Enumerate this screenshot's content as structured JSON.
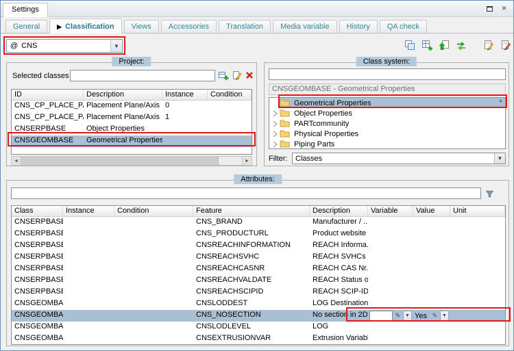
{
  "window": {
    "title": "Settings"
  },
  "tabs": {
    "items": [
      {
        "label": "General"
      },
      {
        "label": "Classification"
      },
      {
        "label": "Views"
      },
      {
        "label": "Accessories"
      },
      {
        "label": "Translation"
      },
      {
        "label": "Media variable"
      },
      {
        "label": "History"
      },
      {
        "label": "QA check"
      }
    ],
    "active": "Classification"
  },
  "class_combo": {
    "icon": "@",
    "value": "CNS"
  },
  "toolbar": {
    "icons": [
      "copy-table-icon",
      "add-table-icon",
      "import-icon",
      "transfer-icon",
      "edit-document-icon",
      "sign-document-icon"
    ]
  },
  "project": {
    "caption": "Project:",
    "selected_classes_label": "Selected classes",
    "search_value": "",
    "columns": [
      "ID",
      "Description",
      "Instance",
      "Condition"
    ],
    "rows": [
      {
        "id": "CNS_CP_PLACE_PA",
        "description": "Placement Plane/Axis",
        "instance": "0",
        "condition": ""
      },
      {
        "id": "CNS_CP_PLACE_PA",
        "description": "Placement Plane/Axis",
        "instance": "1",
        "condition": ""
      },
      {
        "id": "CNSERPBASE",
        "description": "Object Properties",
        "instance": "",
        "condition": ""
      },
      {
        "id": "CNSGEOMBASE",
        "description": "Geometrical Properties",
        "instance": "",
        "condition": ""
      }
    ],
    "selected_id": "CNSGEOMBASE"
  },
  "class_system": {
    "caption": "Class system:",
    "search_value": "",
    "selected_class_header": "CNSGEOMBASE - Geometrical Properties",
    "tree": [
      {
        "label": "Geometrical Properties"
      },
      {
        "label": "Object Properties"
      },
      {
        "label": "PARTcommunity"
      },
      {
        "label": "Physical Properties"
      },
      {
        "label": "Piping Parts"
      }
    ],
    "selected_item": "Geometrical Properties",
    "filter_label": "Filter:",
    "filter_value": "Classes"
  },
  "attributes": {
    "caption": "Attributes:",
    "filter_value": "",
    "columns": [
      "Class",
      "Instance",
      "Condition",
      "Feature",
      "Description",
      "Variable",
      "Value",
      "Unit"
    ],
    "rows": [
      {
        "class": "CNSERPBASE",
        "feature": "CNS_BRAND",
        "description": "Manufacturer / ..."
      },
      {
        "class": "CNSERPBASE",
        "feature": "CNS_PRODUCTURL",
        "description": "Product website"
      },
      {
        "class": "CNSERPBASE",
        "feature": "CNSREACHINFORMATION",
        "description": "REACH Informa..."
      },
      {
        "class": "CNSERPBASE",
        "feature": "CNSREACHSVHC",
        "description": "REACH SVHCs ..."
      },
      {
        "class": "CNSERPBASE",
        "feature": "CNSREACHCASNR",
        "description": "REACH CAS Nr."
      },
      {
        "class": "CNSERPBASE",
        "feature": "CNSREACHVALDATE",
        "description": "REACH Status o..."
      },
      {
        "class": "CNSERPBASE",
        "feature": "CNSREACHSCIPID",
        "description": "REACH SCIP-ID"
      },
      {
        "class": "CNSGEOMBASE",
        "feature": "CNSLODDEST",
        "description": "LOG Destination"
      },
      {
        "class": "CNSGEOMBASE",
        "feature": "CNS_NOSECTION",
        "description": "No section in 2D",
        "value": "Yes"
      },
      {
        "class": "CNSGEOMBASE",
        "feature": "CNSLODLEVEL",
        "description": "LOG"
      },
      {
        "class": "CNSGEOMBASE",
        "feature": "CNSEXTRUSIONVAR",
        "description": "Extrusion Variable"
      }
    ],
    "selected_feature": "CNS_NOSECTION"
  },
  "colors": {
    "selection": "#a9bfd3",
    "caption_bg": "#b5cadb",
    "tab_text": "#31859b",
    "annotation": "#e51616"
  }
}
